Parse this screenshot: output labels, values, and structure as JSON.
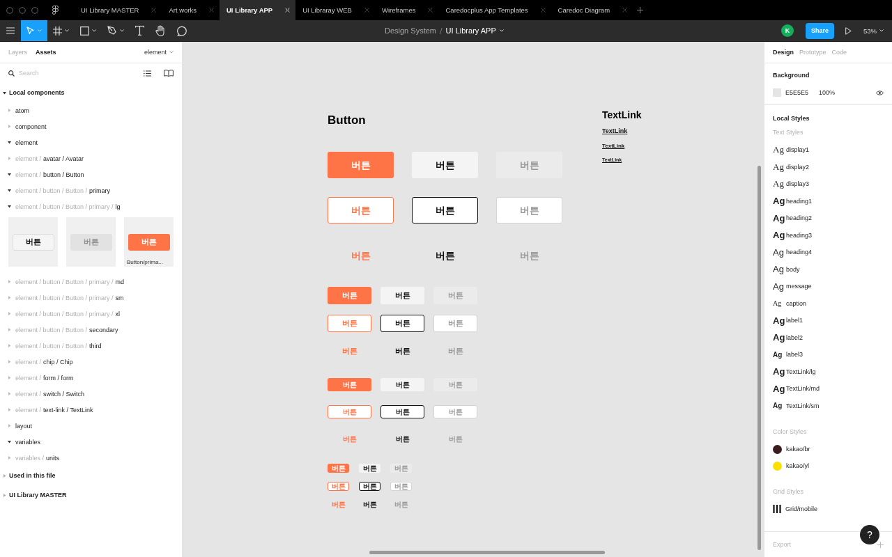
{
  "tabs": [
    {
      "label": "UI Library MASTER",
      "selected": false
    },
    {
      "label": "Art works",
      "selected": false
    },
    {
      "label": "UI Library APP",
      "selected": true
    },
    {
      "label": "UI Libraray WEB",
      "selected": false
    },
    {
      "label": "Wireframes",
      "selected": false
    },
    {
      "label": "Caredocplus App Templates",
      "selected": false
    },
    {
      "label": "Caredoc Diagram",
      "selected": false
    }
  ],
  "toolbar": {
    "tools": [
      {
        "kind": "move",
        "selected": true
      },
      {
        "kind": "frame",
        "selected": false
      },
      {
        "kind": "shape",
        "selected": false
      },
      {
        "kind": "pen",
        "selected": false
      },
      {
        "kind": "text",
        "selected": false
      },
      {
        "kind": "hand",
        "selected": false
      },
      {
        "kind": "comment",
        "selected": false
      }
    ],
    "breadcrumb": {
      "project": "Design System",
      "separator": "/",
      "file": "UI Library APP"
    },
    "user_initial": "K",
    "share": "Share",
    "zoom": "53%"
  },
  "left_panel": {
    "tabs": [
      {
        "label": "Layers",
        "selected": false
      },
      {
        "label": "Assets",
        "selected": true
      }
    ],
    "library": "element",
    "search": {
      "placeholder": "Search"
    },
    "sections": [
      {
        "title": "Local components",
        "expanded": true,
        "items": [
          {
            "name": "atom",
            "expanded": false
          },
          {
            "name": "component",
            "expanded": false
          },
          {
            "name": "element",
            "expanded": true
          },
          {
            "prefix": "element /",
            "name": "avatar / Avatar",
            "expanded": false
          },
          {
            "prefix": "element /",
            "name": "button / Button",
            "expanded": true
          },
          {
            "prefix": "element / button / Button /",
            "name": "primary",
            "expanded": true
          },
          {
            "prefix": "element / button / Button / primary /",
            "name": "lg",
            "expanded": true,
            "thumbnails": [
              {
                "kind": "secondary",
                "label": "버튼"
              },
              {
                "kind": "disabled",
                "label": "버튼"
              },
              {
                "kind": "primary",
                "label": "버튼",
                "caption": "Button/prima..."
              }
            ]
          },
          {
            "prefix": "element / button / Button / primary /",
            "name": "md",
            "expanded": false
          },
          {
            "prefix": "element / button / Button / primary /",
            "name": "sm",
            "expanded": false
          },
          {
            "prefix": "element / button / Button / primary /",
            "name": "xl",
            "expanded": false
          },
          {
            "prefix": "element / button / Button /",
            "name": "secondary",
            "expanded": false
          },
          {
            "prefix": "element / button / Button /",
            "name": "third",
            "expanded": false
          },
          {
            "prefix": "element /",
            "name": "chip / Chip",
            "expanded": false
          },
          {
            "prefix": "element /",
            "name": "form / form",
            "expanded": false
          },
          {
            "prefix": "element /",
            "name": "switch / Switch",
            "expanded": false
          },
          {
            "prefix": "element /",
            "name": "text-link / TextLink",
            "expanded": false
          },
          {
            "name": "layout",
            "expanded": false
          },
          {
            "name": "variables",
            "expanded": true
          },
          {
            "prefix": "variables /",
            "name": "units",
            "expanded": false
          }
        ]
      },
      {
        "title": "Used in this file",
        "expanded": false
      },
      {
        "title": "UI Library MASTER",
        "expanded": false
      }
    ]
  },
  "canvas": {
    "button_frame": {
      "title": "Button",
      "groups": [
        {
          "kind": "xl",
          "rows": [
            {
              "kind": "fill",
              "buttons": [
                {
                  "kind": "primary",
                  "label": "버튼"
                },
                {
                  "kind": "secondary",
                  "label": "버튼"
                },
                {
                  "kind": "disabled",
                  "label": "버튼"
                }
              ]
            },
            {
              "kind": "outline",
              "buttons": [
                {
                  "kind": "primary",
                  "label": "버튼"
                },
                {
                  "kind": "secondary",
                  "label": "버튼"
                },
                {
                  "kind": "disabled",
                  "label": "버튼"
                }
              ]
            },
            {
              "kind": "text",
              "buttons": [
                {
                  "kind": "primary",
                  "label": "버튼"
                },
                {
                  "kind": "secondary",
                  "label": "버튼"
                },
                {
                  "kind": "disabled",
                  "label": "버튼"
                }
              ]
            }
          ]
        },
        {
          "kind": "lg",
          "rows": [
            {
              "kind": "fill",
              "buttons": [
                {
                  "kind": "primary",
                  "label": "버튼"
                },
                {
                  "kind": "secondary",
                  "label": "버튼"
                },
                {
                  "kind": "disabled",
                  "label": "버튼"
                }
              ]
            },
            {
              "kind": "outline",
              "buttons": [
                {
                  "kind": "primary",
                  "label": "버튼"
                },
                {
                  "kind": "secondary",
                  "label": "버튼"
                },
                {
                  "kind": "disabled",
                  "label": "버튼"
                }
              ]
            },
            {
              "kind": "text",
              "buttons": [
                {
                  "kind": "primary",
                  "label": "버튼"
                },
                {
                  "kind": "secondary",
                  "label": "버튼"
                },
                {
                  "kind": "disabled",
                  "label": "버튼"
                }
              ]
            }
          ]
        },
        {
          "kind": "md",
          "rows": [
            {
              "kind": "fill",
              "buttons": [
                {
                  "kind": "primary",
                  "label": "버튼"
                },
                {
                  "kind": "secondary",
                  "label": "버튼"
                },
                {
                  "kind": "disabled",
                  "label": "버튼"
                }
              ]
            },
            {
              "kind": "outline",
              "buttons": [
                {
                  "kind": "primary",
                  "label": "버튼"
                },
                {
                  "kind": "secondary",
                  "label": "버튼"
                },
                {
                  "kind": "disabled",
                  "label": "버튼"
                }
              ]
            },
            {
              "kind": "text",
              "buttons": [
                {
                  "kind": "primary",
                  "label": "버튼"
                },
                {
                  "kind": "secondary",
                  "label": "버튼"
                },
                {
                  "kind": "disabled",
                  "label": "버튼"
                }
              ]
            }
          ]
        },
        {
          "kind": "sm",
          "rows": [
            {
              "kind": "fill",
              "buttons": [
                {
                  "kind": "primary",
                  "label": "버튼"
                },
                {
                  "kind": "secondary",
                  "label": "버튼"
                },
                {
                  "kind": "disabled",
                  "label": "버튼"
                }
              ]
            },
            {
              "kind": "outline",
              "buttons": [
                {
                  "kind": "primary",
                  "label": "버튼"
                },
                {
                  "kind": "secondary",
                  "label": "버튼"
                },
                {
                  "kind": "disabled",
                  "label": "버튼"
                }
              ]
            },
            {
              "kind": "text",
              "buttons": [
                {
                  "kind": "primary",
                  "label": "버튼"
                },
                {
                  "kind": "secondary",
                  "label": "버튼"
                },
                {
                  "kind": "disabled",
                  "label": "버튼"
                }
              ]
            }
          ]
        }
      ]
    },
    "textlink_frame": {
      "title": "TextLink",
      "links": [
        {
          "kind": "lg",
          "label": "TextLink"
        },
        {
          "kind": "md",
          "label": "TextLink"
        },
        {
          "kind": "sm",
          "label": "TextLink"
        }
      ]
    }
  },
  "right_panel": {
    "tabs": [
      {
        "label": "Design",
        "selected": true
      },
      {
        "label": "Prototype",
        "selected": false
      },
      {
        "label": "Code",
        "selected": false
      }
    ],
    "background": {
      "heading": "Background",
      "hex": "E5E5E5",
      "opacity": "100%",
      "visible": true
    },
    "local_styles": {
      "heading": "Local Styles",
      "text_heading": "Text Styles",
      "text_styles": [
        {
          "sample": "Ag",
          "name": "display1",
          "kind": "display"
        },
        {
          "sample": "Ag",
          "name": "display2",
          "kind": "display"
        },
        {
          "sample": "Ag",
          "name": "display3",
          "kind": "display"
        },
        {
          "sample": "Ag",
          "name": "heading1",
          "kind": "bold"
        },
        {
          "sample": "Ag",
          "name": "heading2",
          "kind": "bold"
        },
        {
          "sample": "Ag",
          "name": "heading3",
          "kind": "bold"
        },
        {
          "sample": "Ag",
          "name": "heading4",
          "kind": "regular"
        },
        {
          "sample": "Ag",
          "name": "body",
          "kind": "regular"
        },
        {
          "sample": "Ag",
          "name": "message",
          "kind": "regular"
        },
        {
          "sample": "Ag",
          "name": "caption",
          "kind": "small"
        },
        {
          "sample": "Ag",
          "name": "label1",
          "kind": "bold"
        },
        {
          "sample": "Ag",
          "name": "label2",
          "kind": "bold"
        },
        {
          "sample": "Ag",
          "name": "label3",
          "kind": "small-bold"
        },
        {
          "sample": "Ag",
          "name": "TextLink/lg",
          "kind": "bold"
        },
        {
          "sample": "Ag",
          "name": "TextLink/md",
          "kind": "bold"
        },
        {
          "sample": "Ag",
          "name": "TextLink/sm",
          "kind": "small-bold"
        }
      ],
      "color_heading": "Color Styles",
      "colors": [
        {
          "name": "kakao/br",
          "color": "#3a1d1d"
        },
        {
          "name": "kakao/yl",
          "color": "#f9e000"
        }
      ],
      "grid_heading": "Grid Styles",
      "grids": [
        {
          "name": "Grid/mobile"
        }
      ]
    },
    "export": "Export"
  },
  "help": "?"
}
